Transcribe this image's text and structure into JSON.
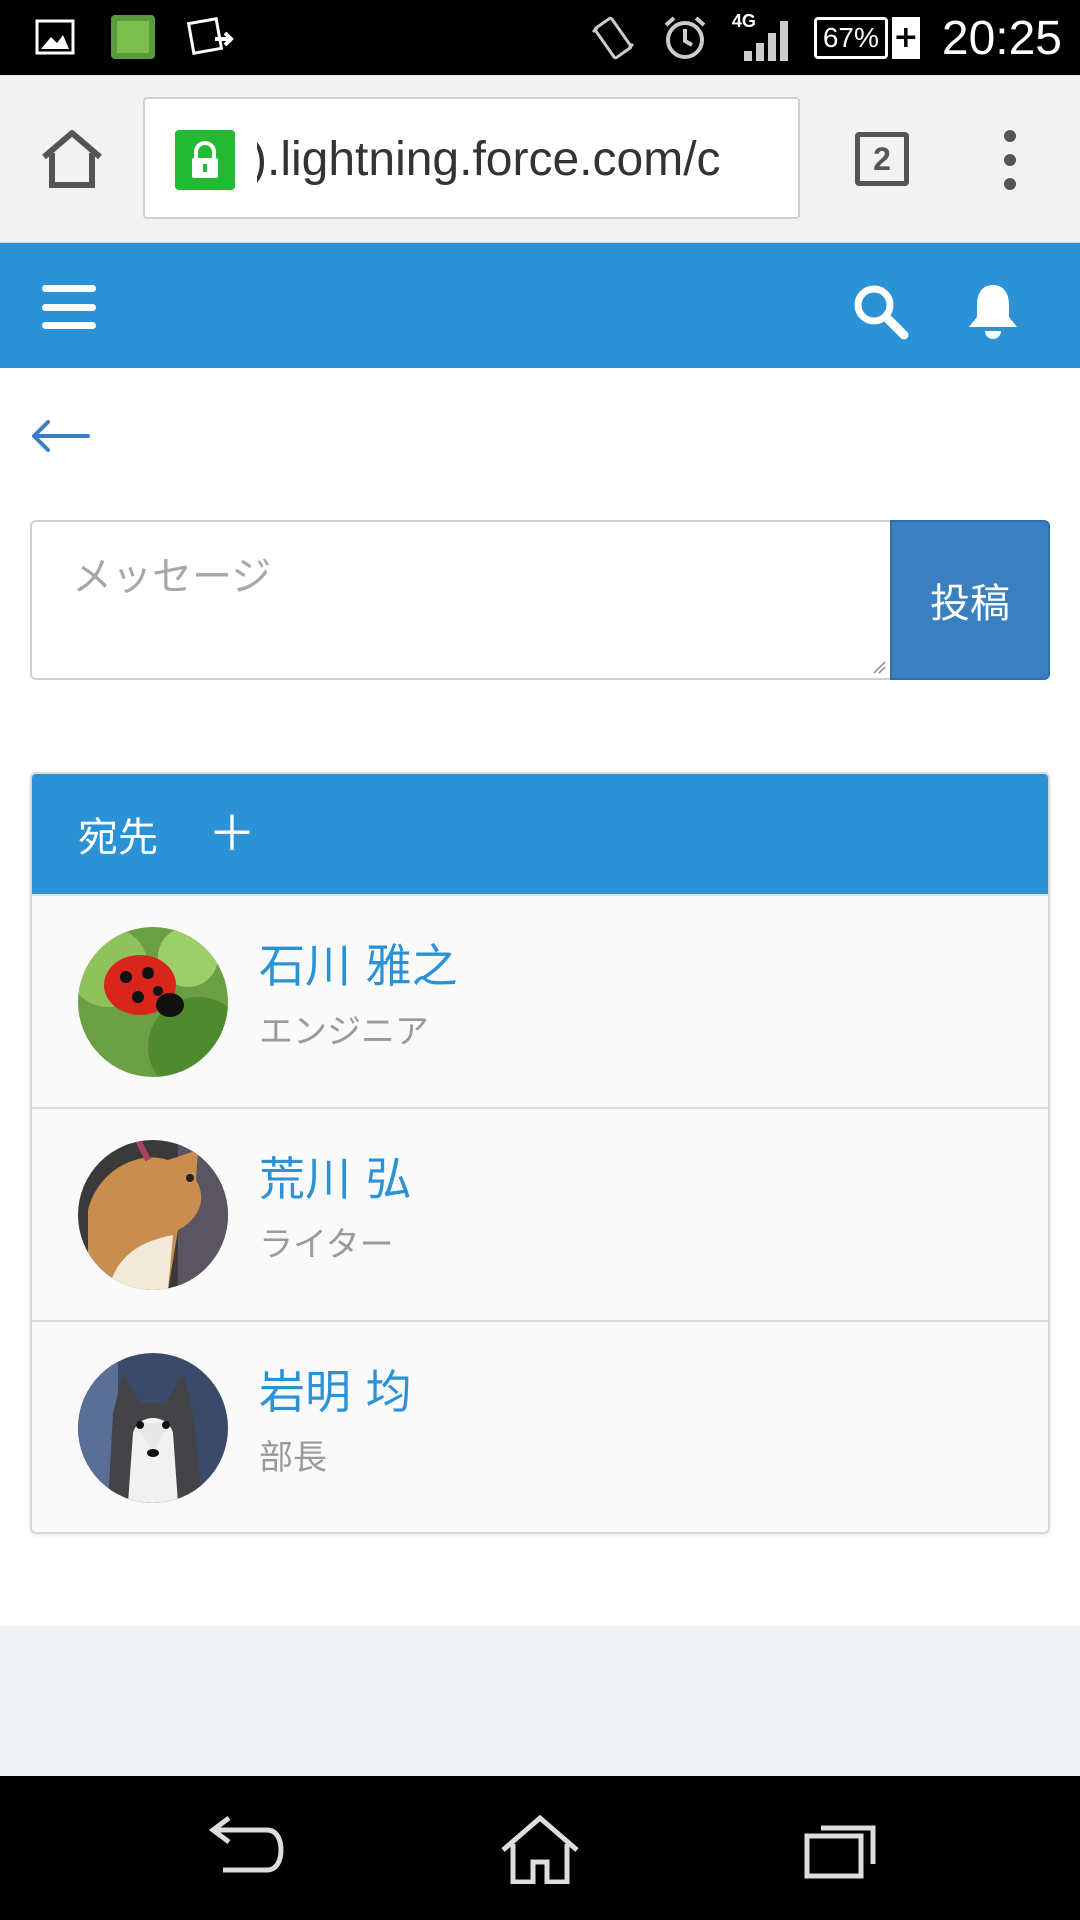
{
  "status_bar": {
    "network": "4G",
    "battery": "67%",
    "time": "20:25",
    "icons": [
      "gallery-icon",
      "mobile-app-icon",
      "screenshot-share-icon",
      "vibrate-icon",
      "alarm-icon",
      "signal-icon"
    ]
  },
  "browser": {
    "url": ").lightning.force.com/c",
    "tab_count": "2"
  },
  "app_header": {
    "color": "#2b93d5"
  },
  "compose": {
    "placeholder": "メッセージ",
    "post_label": "投稿",
    "post_color": "#3a7fbf"
  },
  "recipients": {
    "title": "宛先",
    "add_label": "＋",
    "items": [
      {
        "name": "石川 雅之",
        "role": "エンジニア",
        "avatar": "ladybug"
      },
      {
        "name": "荒川 弘",
        "role": "ライター",
        "avatar": "shiba-dog"
      },
      {
        "name": "岩明 均",
        "role": "部長",
        "avatar": "husky-dog"
      }
    ]
  }
}
